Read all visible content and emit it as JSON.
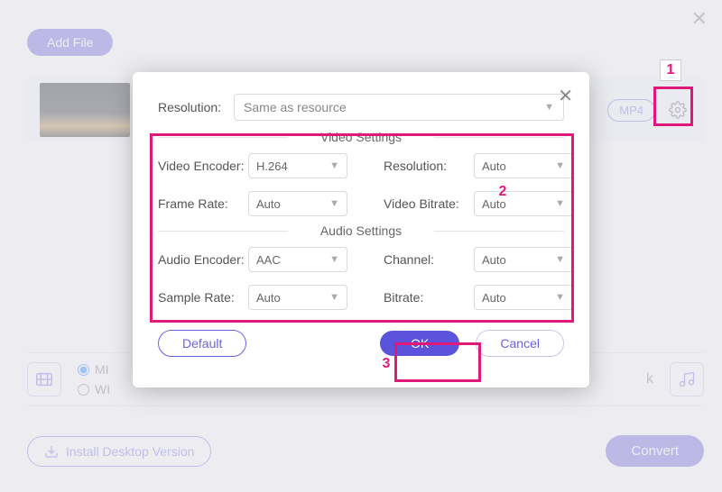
{
  "app": {
    "close_glyph": "✕"
  },
  "toolbar": {
    "add_file_label": "Add File"
  },
  "file_panel": {
    "format_label": "MP4"
  },
  "bottom": {
    "radio1_label": "MI",
    "radio2_label": "WI",
    "k_label": "k"
  },
  "footer": {
    "install_label": "Install Desktop Version",
    "convert_label": "Convert"
  },
  "modal": {
    "close_glyph": "✕",
    "resolution_label": "Resolution:",
    "resolution_value": "Same as resource",
    "video_section": "Video Settings",
    "audio_section": "Audio Settings",
    "video_encoder_label": "Video Encoder:",
    "video_encoder_value": "H.264",
    "frame_rate_label": "Frame Rate:",
    "frame_rate_value": "Auto",
    "res2_label": "Resolution:",
    "res2_value": "Auto",
    "vbitrate_label": "Video Bitrate:",
    "vbitrate_value": "Auto",
    "audio_encoder_label": "Audio Encoder:",
    "audio_encoder_value": "AAC",
    "sample_rate_label": "Sample Rate:",
    "sample_rate_value": "Auto",
    "channel_label": "Channel:",
    "channel_value": "Auto",
    "abitrate_label": "Bitrate:",
    "abitrate_value": "Auto",
    "default_label": "Default",
    "ok_label": "OK",
    "cancel_label": "Cancel"
  },
  "annotations": {
    "n1": "1",
    "n2": "2",
    "n3": "3"
  }
}
